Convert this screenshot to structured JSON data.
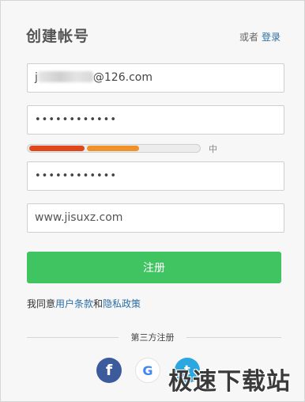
{
  "form": {
    "title": "创建帐号",
    "alt_prefix": "或者",
    "alt_link": "登录",
    "email_suffix": "@126.com",
    "email_prefix_visible": "j",
    "password_mask": "••••••••••••",
    "confirm_mask": "••••••••••••",
    "site_value": "www.jisuxz.com",
    "strength_label": "中",
    "strength_level": 0.66,
    "register_label": "注册",
    "agree_prefix": "我同意",
    "terms_link": "用户条款",
    "agree_and": "和",
    "privacy_link": "隐私政策",
    "third_party_label": "第三方注册"
  },
  "social": {
    "facebook_glyph": "f",
    "google_glyph": "G",
    "twitter_glyph": "t"
  },
  "watermark": {
    "text": "极速下载站"
  },
  "colors": {
    "primary_green": "#40c461",
    "link_blue": "#2a6ea6",
    "strength_red": "#e0471a",
    "strength_orange": "#f0922b",
    "facebook_blue": "#3b5b9c",
    "twitter_blue": "#2aa6e0"
  }
}
